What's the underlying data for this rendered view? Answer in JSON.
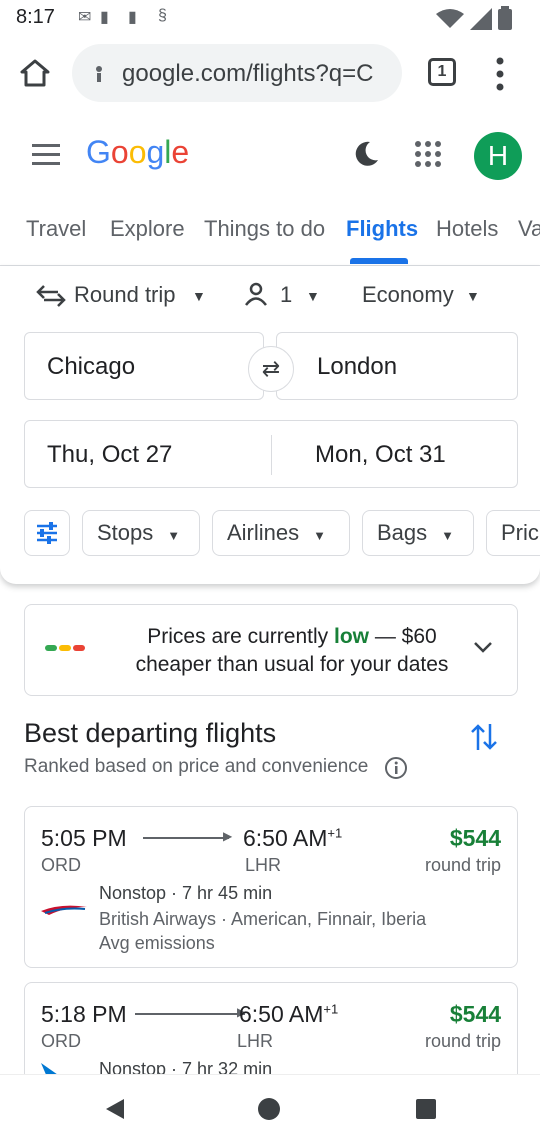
{
  "status_bar": {
    "time": "8:17"
  },
  "browser": {
    "url": "google.com/flights?q=C",
    "tab_count": "1"
  },
  "google": {
    "logo": [
      "G",
      "o",
      "o",
      "g",
      "l",
      "e"
    ],
    "avatar_letter": "H"
  },
  "tabs": [
    "Travel",
    "Explore",
    "Things to do",
    "Flights",
    "Hotels",
    "Va"
  ],
  "search": {
    "trip_type": "Round trip",
    "passengers": "1",
    "cabin": "Economy",
    "origin": "Chicago",
    "destination": "London",
    "depart_date": "Thu, Oct 27",
    "return_date": "Mon, Oct 31"
  },
  "filters": [
    "Stops",
    "Airlines",
    "Bags",
    "Pric"
  ],
  "banner": {
    "line1_a": "Prices are currently ",
    "line1_low": "low",
    "line1_b": " — $60",
    "line2": "cheaper than usual for your dates"
  },
  "section": {
    "title": "Best departing flights",
    "subtitle": "Ranked based on price and convenience"
  },
  "flights": [
    {
      "depart": "5:05 PM",
      "arrive": "6:50 AM",
      "plus": "+1",
      "from": "ORD",
      "to": "LHR",
      "price": "$544",
      "price_note": "round trip",
      "stops": "Nonstop · 7 hr 45 min",
      "airlines": "British Airways · American, Finnair, Iberia",
      "emissions": "Avg emissions"
    },
    {
      "depart": "5:18 PM",
      "arrive": "6:50 AM",
      "plus": "+1",
      "from": "ORD",
      "to": "LHR",
      "price": "$544",
      "price_note": "round trip",
      "stops": "Nonstop · 7 hr 32 min"
    }
  ],
  "colors": {
    "accent": "#1a73e8",
    "price": "#188038"
  }
}
